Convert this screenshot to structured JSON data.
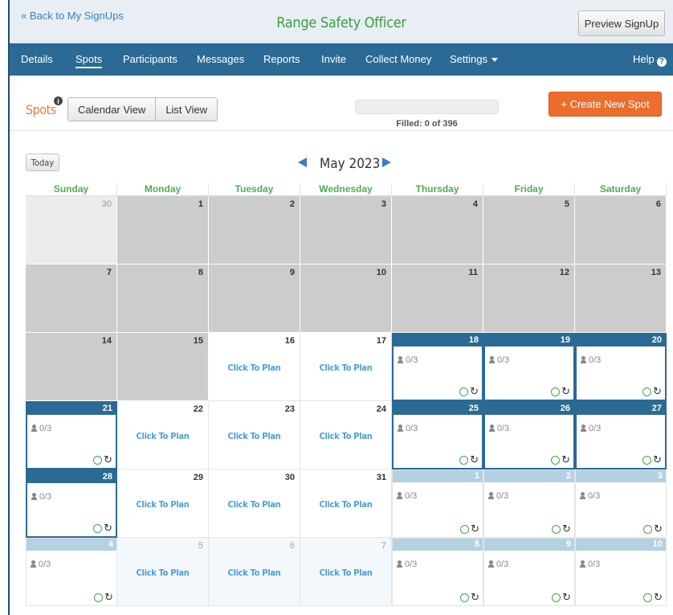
{
  "header": {
    "back_link": "« Back to My SignUps",
    "title": "Range Safety Officer",
    "preview_button": "Preview SignUp"
  },
  "nav": {
    "items": [
      "Details",
      "Spots",
      "Participants",
      "Messages",
      "Reports",
      "Invite",
      "Collect Money",
      "Settings"
    ],
    "active": "Spots",
    "help": "Help"
  },
  "toolbar": {
    "spots_label": "Spots",
    "calendar_view": "Calendar View",
    "list_view": "List View",
    "filled_text": "Filled: 0 of 396",
    "filled_fraction": 0,
    "create_button": "+ Create New Spot"
  },
  "calendar": {
    "today_button": "Today",
    "month_label": "May 2023",
    "weekdays": [
      "Sunday",
      "Monday",
      "Tuesday",
      "Wednesday",
      "Thursday",
      "Friday",
      "Saturday"
    ],
    "click_to_plan": "Click To Plan",
    "spot_count": "0/3",
    "weeks": [
      [
        {
          "day": "30",
          "type": "grey-light"
        },
        {
          "day": "1",
          "type": "grey"
        },
        {
          "day": "2",
          "type": "grey"
        },
        {
          "day": "3",
          "type": "grey"
        },
        {
          "day": "4",
          "type": "grey"
        },
        {
          "day": "5",
          "type": "grey"
        },
        {
          "day": "6",
          "type": "grey"
        }
      ],
      [
        {
          "day": "7",
          "type": "grey"
        },
        {
          "day": "8",
          "type": "grey"
        },
        {
          "day": "9",
          "type": "grey"
        },
        {
          "day": "10",
          "type": "grey"
        },
        {
          "day": "11",
          "type": "grey"
        },
        {
          "day": "12",
          "type": "grey"
        },
        {
          "day": "13",
          "type": "grey"
        }
      ],
      [
        {
          "day": "14",
          "type": "grey"
        },
        {
          "day": "15",
          "type": "grey"
        },
        {
          "day": "16",
          "type": "plan"
        },
        {
          "day": "17",
          "type": "plan"
        },
        {
          "day": "18",
          "type": "spot"
        },
        {
          "day": "19",
          "type": "spot"
        },
        {
          "day": "20",
          "type": "spot"
        }
      ],
      [
        {
          "day": "21",
          "type": "spot"
        },
        {
          "day": "22",
          "type": "plan"
        },
        {
          "day": "23",
          "type": "plan"
        },
        {
          "day": "24",
          "type": "plan"
        },
        {
          "day": "25",
          "type": "spot"
        },
        {
          "day": "26",
          "type": "spot"
        },
        {
          "day": "27",
          "type": "spot"
        }
      ],
      [
        {
          "day": "28",
          "type": "spot"
        },
        {
          "day": "29",
          "type": "plan"
        },
        {
          "day": "30",
          "type": "plan"
        },
        {
          "day": "31",
          "type": "plan"
        },
        {
          "day": "1",
          "type": "spot-next"
        },
        {
          "day": "2",
          "type": "spot-next"
        },
        {
          "day": "3",
          "type": "spot-next"
        }
      ],
      [
        {
          "day": "4",
          "type": "spot-next"
        },
        {
          "day": "5",
          "type": "plan-next"
        },
        {
          "day": "6",
          "type": "plan-next"
        },
        {
          "day": "7",
          "type": "plan-next"
        },
        {
          "day": "8",
          "type": "spot-next"
        },
        {
          "day": "9",
          "type": "spot-next"
        },
        {
          "day": "10",
          "type": "spot-next"
        }
      ]
    ]
  },
  "colors": {
    "nav_bg": "#2b6a94",
    "title_green": "#3aa040",
    "accent_orange": "#ed6d2d",
    "link_blue": "#3a7ec4"
  }
}
